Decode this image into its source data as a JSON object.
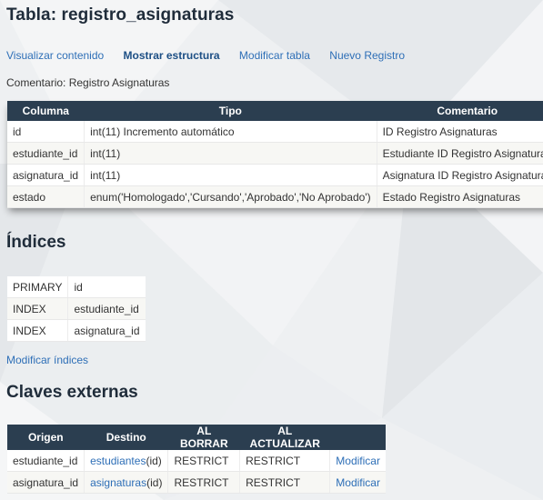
{
  "page": {
    "title": "Tabla: registro_asignaturas",
    "comment": "Comentario: Registro Asignaturas"
  },
  "tabs": [
    {
      "label": "Visualizar contenido",
      "active": false
    },
    {
      "label": "Mostrar estructura",
      "active": true
    },
    {
      "label": "Modificar tabla",
      "active": false
    },
    {
      "label": "Nuevo Registro",
      "active": false
    }
  ],
  "structure": {
    "headers": [
      "Columna",
      "Tipo",
      "Comentario"
    ],
    "rows": [
      {
        "columna": "id",
        "tipo": "int(11) Incremento automático",
        "comentario": "ID Registro Asignaturas"
      },
      {
        "columna": "estudiante_id",
        "tipo": "int(11)",
        "comentario": "Estudiante ID Registro Asignaturas"
      },
      {
        "columna": "asignatura_id",
        "tipo": "int(11)",
        "comentario": "Asignatura ID Registro Asignaturas"
      },
      {
        "columna": "estado",
        "tipo": "enum('Homologado','Cursando','Aprobado','No Aprobado')",
        "comentario": "Estado Registro Asignaturas"
      }
    ]
  },
  "indices": {
    "heading": "Índices",
    "rows": [
      {
        "type": "PRIMARY",
        "column": "id"
      },
      {
        "type": "INDEX",
        "column": "estudiante_id"
      },
      {
        "type": "INDEX",
        "column": "asignatura_id"
      }
    ],
    "modify_link": "Modificar índices"
  },
  "foreign_keys": {
    "heading": "Claves externas",
    "headers": [
      "Origen",
      "Destino",
      "AL BORRAR",
      "AL ACTUALIZAR",
      ""
    ],
    "rows": [
      {
        "origen": "estudiante_id",
        "destino_table": "estudiantes",
        "destino_col": "(id)",
        "on_delete": "RESTRICT",
        "on_update": "RESTRICT",
        "action": "Modificar"
      },
      {
        "origen": "asignatura_id",
        "destino_table": "asignaturas",
        "destino_col": "(id)",
        "on_delete": "RESTRICT",
        "on_update": "RESTRICT",
        "action": "Modificar"
      }
    ]
  },
  "colors": {
    "header_bg": "#2b3e50",
    "link": "#2e6fb7",
    "title": "#1f2c3a"
  }
}
